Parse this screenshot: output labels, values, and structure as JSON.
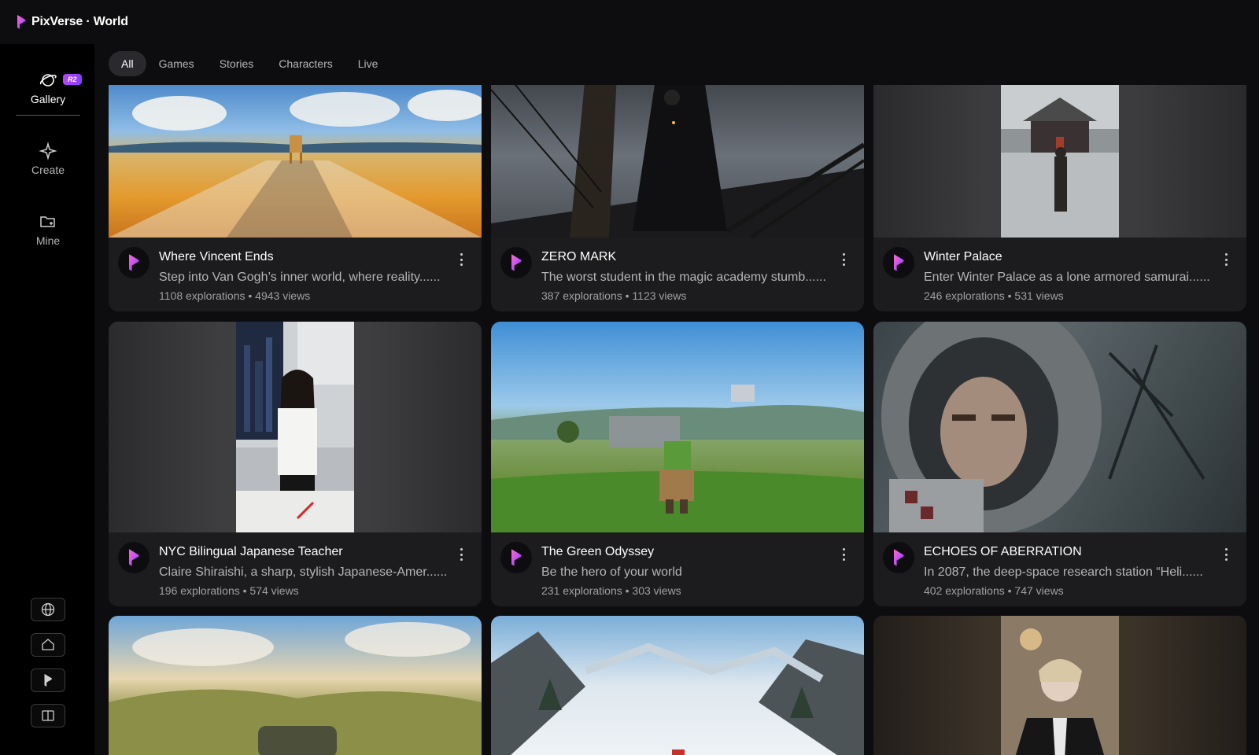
{
  "brand": {
    "name": "PixVerse · World"
  },
  "sidebar": {
    "items": [
      {
        "label": "Gallery",
        "badge": "R2",
        "icon": "planet-icon"
      },
      {
        "label": "Create",
        "icon": "sparkle-icon"
      },
      {
        "label": "Mine",
        "icon": "folder-icon"
      }
    ],
    "bottom_buttons": [
      "globe-icon",
      "home-icon",
      "pixverse-logo-icon",
      "book-icon"
    ]
  },
  "tabs": [
    "All",
    "Games",
    "Stories",
    "Characters",
    "Live"
  ],
  "active_tab": "All",
  "cards": [
    {
      "title": "Where Vincent Ends",
      "desc": "Step into Van Gogh’s inner world, where reality......",
      "stats": "1108 explorations • 4943 views"
    },
    {
      "title": "ZERO MARK",
      "desc": "The worst student in the magic academy stumb......",
      "stats": "387 explorations • 1123 views"
    },
    {
      "title": "Winter Palace",
      "desc": "Enter Winter Palace as a lone armored samurai......",
      "stats": "246 explorations • 531 views"
    },
    {
      "title": "NYC Bilingual Japanese Teacher",
      "desc": "Claire Shiraishi, a sharp, stylish Japanese-Amer......",
      "stats": "196 explorations • 574 views"
    },
    {
      "title": "The Green Odyssey",
      "desc": "Be the hero of your world",
      "stats": "231 explorations • 303 views"
    },
    {
      "title": "ECHOES OF ABERRATION",
      "desc": "In 2087, the deep-space research station “Heli......",
      "stats": "402 explorations • 747 views"
    }
  ],
  "colors": {
    "accent": "#b347ff",
    "background": "#0d0d0f",
    "card": "#1c1c1f"
  }
}
